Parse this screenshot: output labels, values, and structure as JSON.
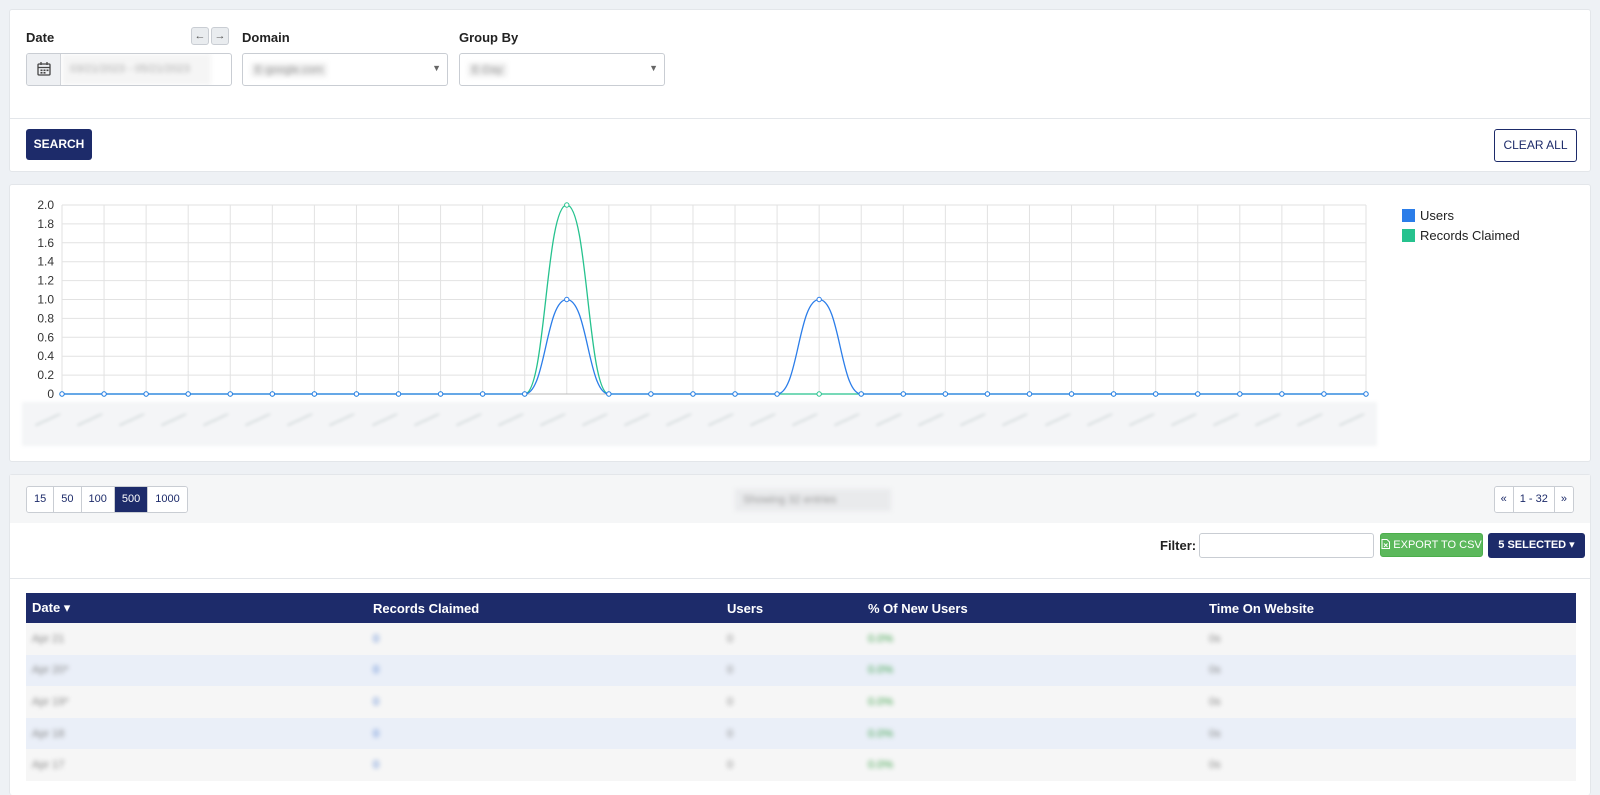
{
  "filters": {
    "date_label": "Date",
    "date_value": "03/21/2023 - 05/21/2023",
    "prev_arrow": "←",
    "next_arrow": "→",
    "domain_label": "Domain",
    "domain_value": "E-google.com",
    "group_label": "Group By",
    "group_value": "E-Day",
    "search_label": "SEARCH",
    "clear_label": "CLEAR ALL"
  },
  "chart_data": {
    "type": "line",
    "ylim": [
      0,
      2.0
    ],
    "yticks": [
      "0",
      "0.2",
      "0.4",
      "0.6",
      "0.8",
      "1.0",
      "1.2",
      "1.4",
      "1.6",
      "1.8",
      "2.0"
    ],
    "x_count": 32,
    "grid": true,
    "legend_position": "right",
    "series": [
      {
        "name": "Users",
        "color": "#2b7de9",
        "values": [
          0,
          0,
          0,
          0,
          0,
          0,
          0,
          0,
          0,
          0,
          0,
          0,
          1,
          0,
          0,
          0,
          0,
          0,
          1,
          0,
          0,
          0,
          0,
          0,
          0,
          0,
          0,
          0,
          0,
          0,
          0,
          0
        ]
      },
      {
        "name": "Records Claimed",
        "color": "#26c28e",
        "values": [
          0,
          0,
          0,
          0,
          0,
          0,
          0,
          0,
          0,
          0,
          0,
          0,
          2,
          0,
          0,
          0,
          0,
          0,
          0,
          0,
          0,
          0,
          0,
          0,
          0,
          0,
          0,
          0,
          0,
          0,
          0,
          0
        ]
      }
    ]
  },
  "table_controls": {
    "page_sizes": [
      "15",
      "50",
      "100",
      "500",
      "1000"
    ],
    "active_page_size": "500",
    "showing": "Showing 32 entries",
    "pager_prev": "«",
    "pager_range": "1 - 32",
    "pager_next": "»",
    "filter_label": "Filter:",
    "export_label": "EXPORT TO CSV",
    "export_icon": "file-excel-icon",
    "selected_label": "5 SELECTED ▾"
  },
  "table": {
    "columns": [
      "Date ▾",
      "Records Claimed",
      "Users",
      "% Of New Users",
      "Time On Website"
    ],
    "rows": [
      {
        "date": "Apr 21",
        "records": "0",
        "users": "0",
        "pct": "0.0%",
        "time": "0s"
      },
      {
        "date": "Apr 20*",
        "records": "0",
        "users": "0",
        "pct": "0.0%",
        "time": "0s"
      },
      {
        "date": "Apr 19*",
        "records": "0",
        "users": "0",
        "pct": "0.0%",
        "time": "0s"
      },
      {
        "date": "Apr 18",
        "records": "0",
        "users": "0",
        "pct": "0.0%",
        "time": "0s"
      },
      {
        "date": "Apr 17",
        "records": "0",
        "users": "0",
        "pct": "0.0%",
        "time": "0s"
      }
    ]
  }
}
